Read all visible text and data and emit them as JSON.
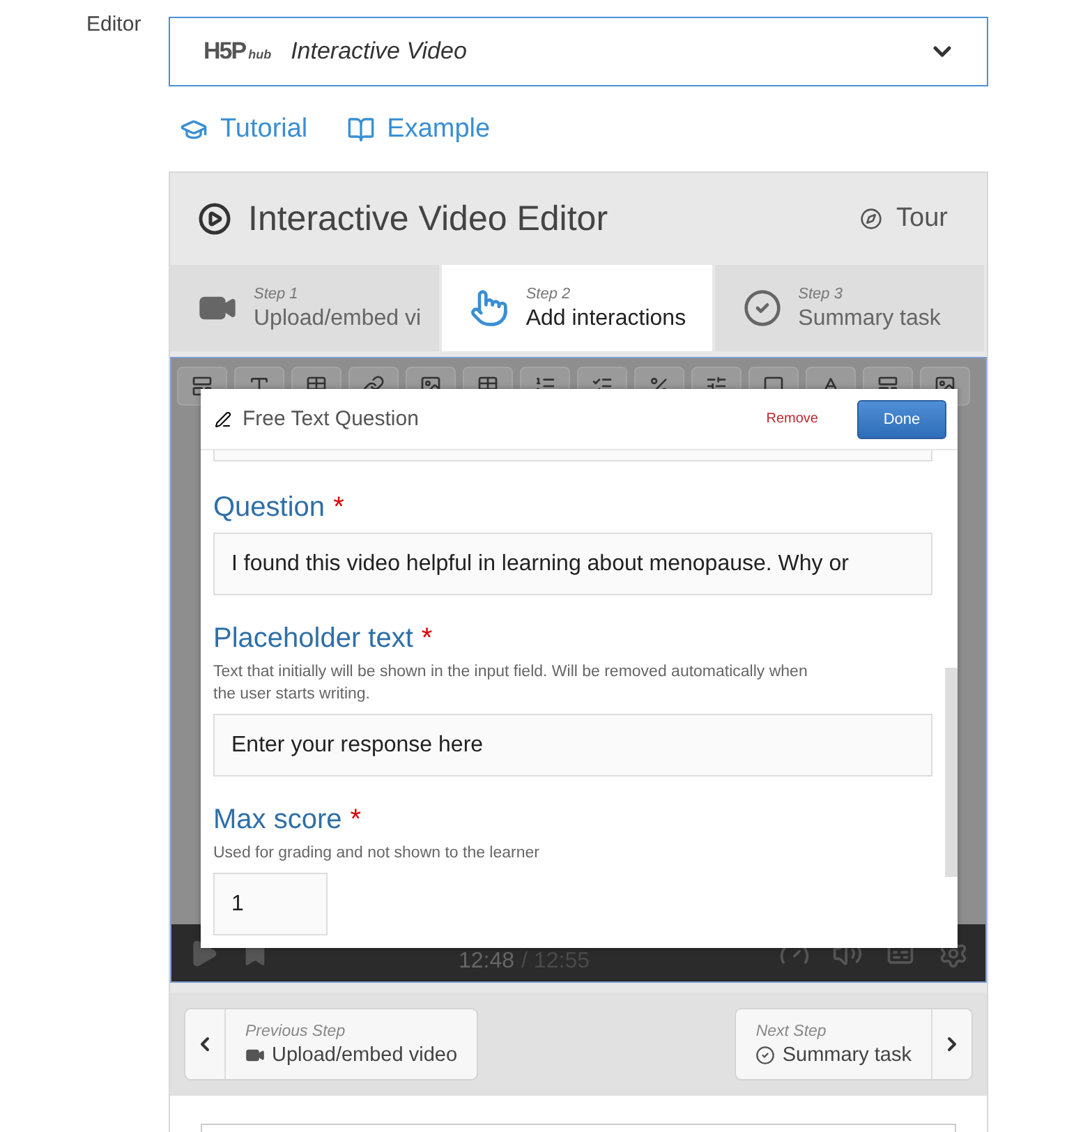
{
  "field_label": "Editor",
  "content_type": {
    "logo": "H5P",
    "logo_sub": "hub",
    "name": "Interactive Video"
  },
  "links": [
    {
      "kind": "tutorial",
      "label": "Tutorial"
    },
    {
      "kind": "example",
      "label": "Example"
    }
  ],
  "editor": {
    "title": "Interactive Video Editor",
    "tour": "Tour",
    "steps": [
      {
        "kind": "video",
        "step": "Step 1",
        "label": "Upload/embed vi",
        "selected": false
      },
      {
        "kind": "touch",
        "step": "Step 2",
        "label": "Add interactions",
        "selected": true
      },
      {
        "kind": "check",
        "step": "Step 3",
        "label": "Summary task",
        "selected": false
      }
    ],
    "player": {
      "current_time": "12:48",
      "separator": "/",
      "total_time": "12:55"
    },
    "dialog": {
      "title": "Free Text Question",
      "remove": "Remove",
      "done": "Done",
      "required_mark": "*",
      "fields": [
        {
          "label": "Question",
          "required": true,
          "value": "I found this video helpful in learning about menopause. Why or",
          "kind": "wide"
        },
        {
          "label": "Placeholder text",
          "required": true,
          "description": "Text that initially will be shown in the input field. Will be removed automatically when the user starts writing.",
          "value": "Enter your response here",
          "kind": "wide"
        },
        {
          "label": "Max score",
          "required": true,
          "description": "Used for grading and not shown to the learner",
          "value": "1",
          "kind": "narrow"
        }
      ]
    },
    "nav": {
      "previous": {
        "caption": "Previous Step",
        "label": "Upload/embed video"
      },
      "next": {
        "caption": "Next Step",
        "label": "Summary task"
      }
    }
  }
}
